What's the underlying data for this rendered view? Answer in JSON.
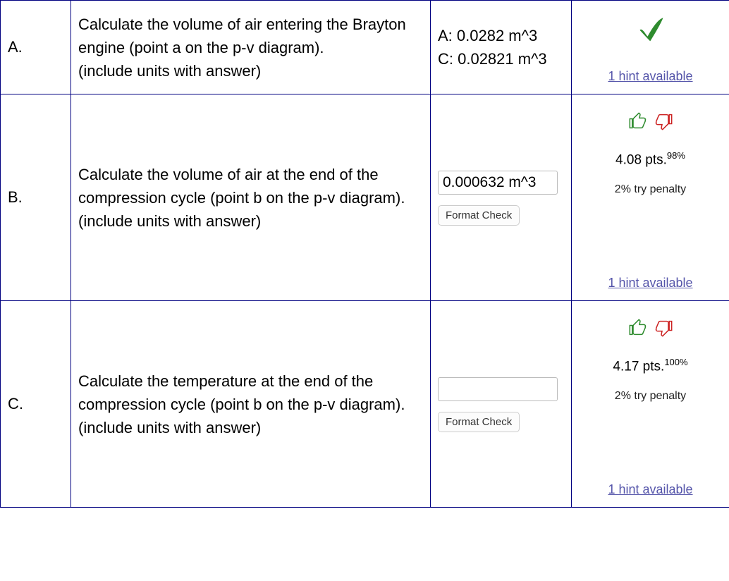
{
  "rows": [
    {
      "label": "A.",
      "question": "Calculate the volume of air entering the Brayton engine (point a on the p-v diagram).\n(include units with answer)",
      "answer_text": "A: 0.0282 m^3\nC: 0.02821 m^3",
      "has_input": false,
      "status": {
        "show_check": true,
        "show_thumbs": false,
        "points": "",
        "percent": "",
        "penalty": "",
        "hint": "1 hint available"
      }
    },
    {
      "label": "B.",
      "question": "Calculate the volume of air at the end of the compression cycle (point b on the p-v diagram).\n(include units with answer)",
      "answer_text": "",
      "has_input": true,
      "input_value": "0.000632 m^3",
      "format_check": "Format Check",
      "status": {
        "show_check": false,
        "show_thumbs": true,
        "points": "4.08 pts.",
        "percent": "98%",
        "penalty": "2% try penalty",
        "hint": "1 hint available"
      }
    },
    {
      "label": "C.",
      "question": "Calculate the temperature at the end of the compression cycle (point b on the p-v diagram).\n(include units with answer)",
      "answer_text": "",
      "has_input": true,
      "input_value": "",
      "format_check": "Format Check",
      "status": {
        "show_check": false,
        "show_thumbs": true,
        "points": "4.17 pts.",
        "percent": "100%",
        "penalty": "2% try penalty",
        "hint": "1 hint available"
      }
    }
  ]
}
